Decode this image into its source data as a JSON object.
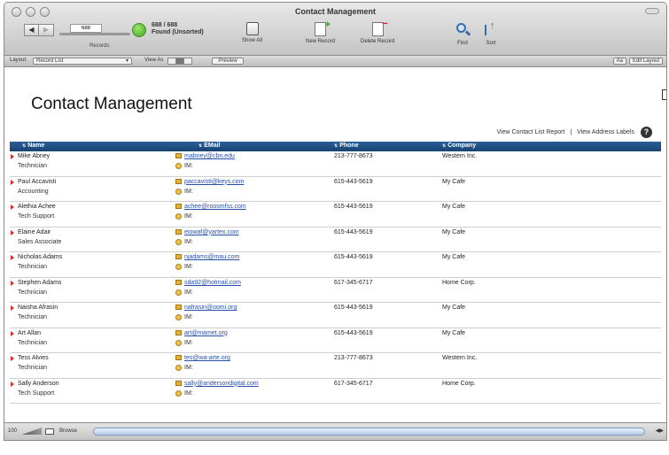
{
  "window": {
    "title": "Contact Management"
  },
  "toolbar": {
    "record_value": "688",
    "found_count": "688 / 688",
    "found_status": "Found (Unsorted)",
    "records_label": "Records",
    "show_all_label": "Show All",
    "new_record_label": "New Record",
    "delete_record_label": "Delete Record",
    "find_label": "Find",
    "sort_label": "Sort"
  },
  "layoutbar": {
    "layout_label": "Layout:",
    "layout_value": "Record List",
    "view_as_label": "View As",
    "preview_label": "Preview",
    "font_button": "Aa",
    "edit_layout_label": "Edit Layout"
  },
  "page": {
    "title": "Contact Management",
    "report_link_1": "View Contact List Report",
    "separator": "|",
    "report_link_2": "View Address Labels",
    "help_icon": "?"
  },
  "columns": {
    "name": "Name",
    "email": "EMail",
    "phone": "Phone",
    "company": "Company"
  },
  "contacts": [
    {
      "name": "Mike Abney",
      "title": "Technician",
      "email": "mabney@cbn.edu",
      "im": "IM:",
      "phone": "213-777-8673",
      "company": "Western Inc."
    },
    {
      "name": "Paul Accavisti",
      "title": "Accounting",
      "email": "paccavisti@keys.com",
      "im": "IM:",
      "phone": "615-443-5619",
      "company": "My Cafe"
    },
    {
      "name": "Alethia Achee",
      "title": "Tech Support",
      "email": "achee@roosmfss.com",
      "im": "IM:",
      "phone": "615-443-5619",
      "company": "My Cafe"
    },
    {
      "name": "Elaine Adair",
      "title": "Sales Associate",
      "email": "eiowaf@yartex.com",
      "im": "IM:",
      "phone": "615-443-5619",
      "company": "My Cafe"
    },
    {
      "name": "Nicholas Adams",
      "title": "Technician",
      "email": "njadams@mau.com",
      "im": "IM:",
      "phone": "615-443-5619",
      "company": "My Cafe"
    },
    {
      "name": "Stephen Adams",
      "title": "Technician",
      "email": "sda92@hotmail.com",
      "im": "IM:",
      "phone": "617-345-6717",
      "company": "Home Corp."
    },
    {
      "name": "Naisha Afrasin",
      "title": "Technician",
      "email": "nafrasin@oomi.org",
      "im": "IM:",
      "phone": "615-443-5619",
      "company": "My Cafe"
    },
    {
      "name": "Art Allan",
      "title": "Technician",
      "email": "art@mamet.org",
      "im": "IM:",
      "phone": "615-443-5619",
      "company": "My Cafe"
    },
    {
      "name": "Tess Alvies",
      "title": "Technician",
      "email": "tes@wa-arte.org",
      "im": "IM:",
      "phone": "213-777-8673",
      "company": "Western Inc."
    },
    {
      "name": "Sally Anderson",
      "title": "Tech Support",
      "email": "sally@andersondigital.com",
      "im": "IM:",
      "phone": "617-345-6717",
      "company": "Home Corp."
    }
  ],
  "status": {
    "zoom": "100",
    "mode": "Browse"
  }
}
